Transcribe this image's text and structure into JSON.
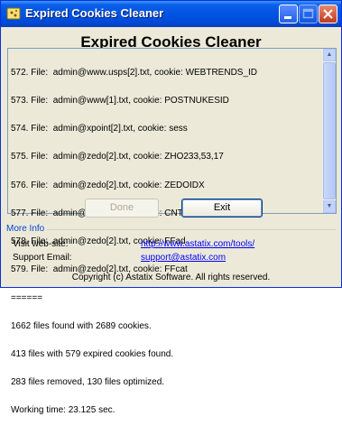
{
  "window": {
    "title": "Expired Cookies Cleaner",
    "titlebar_color": "#0054e3"
  },
  "main": {
    "heading": "Expired Cookies Cleaner",
    "log_lines": [
      "572. File:  admin@www.usps[2].txt, cookie: WEBTRENDS_ID",
      "573. File:  admin@www[1].txt, cookie: POSTNUKESID",
      "574. File:  admin@xpoint[2].txt, cookie: sess",
      "575. File:  admin@zedo[2].txt, cookie: ZHO233,53,17",
      "576. File:  admin@zedo[2].txt, cookie: ZEDOIDX",
      "577. File:  admin@zedo[2].txt, cookie: CNT233,53,17",
      "578. File:  admin@zedo[2].txt, cookie: FFad",
      "579. File:  admin@zedo[2].txt, cookie: FFcat",
      "======",
      "1662 files found with 2689 cookies.",
      "413 files with 579 expired cookies found.",
      "283 files removed, 130 files optimized.",
      "Working time: 23.125 sec."
    ]
  },
  "buttons": {
    "done_label": "Done",
    "exit_label": "Exit"
  },
  "info": {
    "section_label": "More Info",
    "website_label": "Visit web-site:",
    "website_url": "http://www.astatix.com/tools/",
    "email_label": "Support Email:",
    "email_address": "support@astatix.com"
  },
  "footer": {
    "copyright": "Copyright (c) Astatix Software. All rights reserved."
  }
}
